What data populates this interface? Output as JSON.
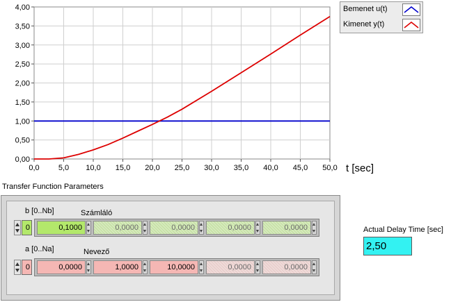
{
  "plot": {
    "x_axis_label": "t [sec]",
    "x_ticks": [
      "0,0",
      "5,0",
      "10,0",
      "15,0",
      "20,0",
      "25,0",
      "30,0",
      "35,0",
      "40,0",
      "45,0",
      "50,0"
    ],
    "y_ticks": [
      "0,00",
      "0,50",
      "1,00",
      "1,50",
      "2,00",
      "2,50",
      "3,00",
      "3,50",
      "4,00"
    ],
    "colors": {
      "background": "#ffffff",
      "grid": "#cfcfcf",
      "input": "#0000cc",
      "output": "#dd0000"
    }
  },
  "legend": {
    "items": [
      {
        "label": "Bemenet u(t)",
        "color": "#0000cc"
      },
      {
        "label": "Kimenet y(t)",
        "color": "#dd0000"
      }
    ]
  },
  "chart_data": {
    "type": "line",
    "xlabel": "t [sec]",
    "ylabel": "",
    "xlim": [
      0,
      50
    ],
    "ylim": [
      0,
      4
    ],
    "x_ticks": [
      0,
      5,
      10,
      15,
      20,
      25,
      30,
      35,
      40,
      45,
      50
    ],
    "y_ticks": [
      0,
      0.5,
      1,
      1.5,
      2,
      2.5,
      3,
      3.5,
      4
    ],
    "grid": true,
    "legend_position": "right",
    "series": [
      {
        "name": "Bemenet u(t)",
        "color": "#0000cc",
        "x": [
          0,
          50
        ],
        "y": [
          1,
          1
        ]
      },
      {
        "name": "Kimenet y(t)",
        "color": "#dd0000",
        "x": [
          0,
          2.5,
          5,
          7.5,
          10,
          12.5,
          15,
          17.5,
          20,
          22.5,
          25,
          30,
          35,
          40,
          45,
          50
        ],
        "y": [
          0,
          0,
          0.03,
          0.12,
          0.24,
          0.38,
          0.55,
          0.73,
          0.91,
          1.1,
          1.31,
          1.78,
          2.27,
          2.76,
          3.26,
          3.75
        ]
      }
    ]
  },
  "transfer_function": {
    "title": "Transfer Function Parameters",
    "numerator": {
      "index_label": "b [0..Nb]",
      "name": "Számláló",
      "index": "0",
      "index_bg": "#b3e86b",
      "values": [
        "0,1000",
        "0,0000",
        "0,0000",
        "0,0000",
        "0,0000"
      ],
      "active_bg": "#b3e86b",
      "dim_bg": "#c8e2a8"
    },
    "denominator": {
      "index_label": "a [0..Na]",
      "name": "Nevező",
      "index": "0",
      "index_bg": "#f5b7b4",
      "values": [
        "0,0000",
        "1,0000",
        "10,0000",
        "0,0000",
        "0,0000"
      ],
      "active_bg": "#f5b7b4",
      "dim_bg": "#e9cfcd"
    }
  },
  "delay": {
    "label": "Actual Delay Time [sec]",
    "value": "2,50",
    "bg": "#33f2f2"
  }
}
